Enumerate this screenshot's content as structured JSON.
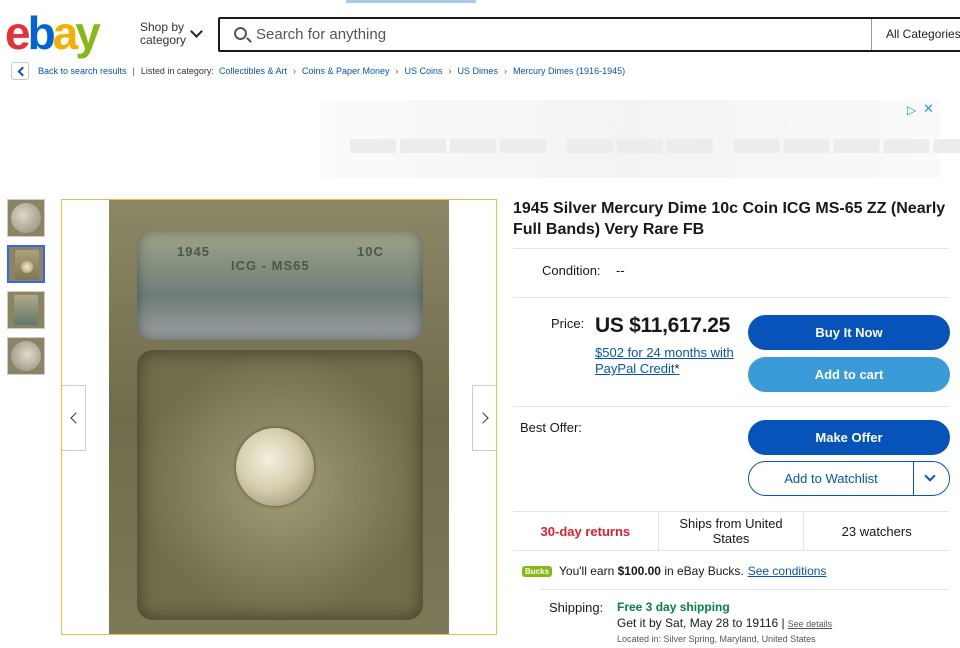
{
  "header": {
    "logo": {
      "e": "e",
      "b": "b",
      "a": "a",
      "y": "y"
    },
    "shop_by_category": "Shop by category",
    "search_placeholder": "Search for anything",
    "category_select": "All Categories"
  },
  "breadcrumb": {
    "back_label": "Back to search results",
    "listed_label": "Listed in category:",
    "items": [
      "Collectibles & Art",
      "Coins & Paper Money",
      "US Coins",
      "US Dimes",
      "Mercury Dimes (1916-1945)"
    ]
  },
  "gallery": {
    "slab_label_year": "1945",
    "slab_label_grade": "ICG - MS65",
    "slab_label_denom": "10C"
  },
  "item": {
    "title": "1945 Silver Mercury Dime 10c Coin ICG MS-65 ZZ (Nearly Full Bands) Very Rare FB",
    "condition_label": "Condition:",
    "condition_value": "--",
    "price_label": "Price:",
    "price": "US $11,617.25",
    "finance_text": "$502 for 24 months with PayPal Credit",
    "finance_star": "*",
    "best_offer_label": "Best Offer:"
  },
  "buttons": {
    "buy_now": "Buy It Now",
    "add_to_cart": "Add to cart",
    "make_offer": "Make Offer",
    "add_to_watchlist": "Add to Watchlist"
  },
  "features": {
    "returns": "30-day returns",
    "ships_from": "Ships from United States",
    "watchers": "23 watchers"
  },
  "bucks": {
    "badge": "Bucks",
    "text_prefix": "You'll earn",
    "amount": "$100.00",
    "text_suffix": "in eBay Bucks.",
    "link": "See conditions"
  },
  "shipping": {
    "label": "Shipping:",
    "free": "Free 3 day shipping",
    "eta": "Get it by Sat, May 28 to 19116 |",
    "details_link": "See details",
    "location": "Located in: Silver Spring, Maryland, United States"
  },
  "colors": {
    "brand_blue": "#0654ba",
    "returns_red": "#dd1e31",
    "free_ship_green": "#05823f"
  }
}
